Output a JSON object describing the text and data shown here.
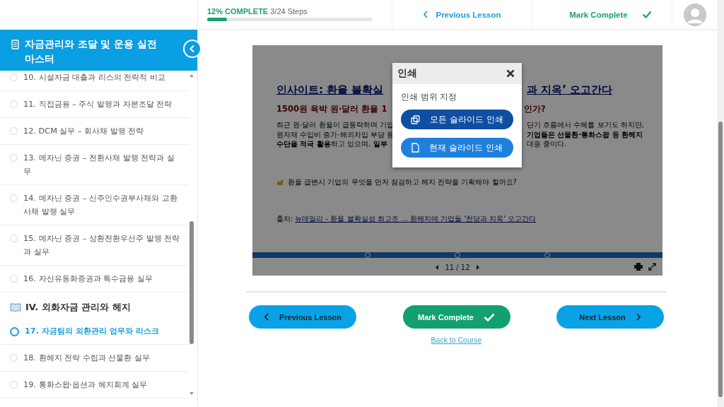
{
  "progress": {
    "percent_label": "12% COMPLETE",
    "steps": "3/24 Steps",
    "level": 0.12
  },
  "top_nav": {
    "previous": "Previous Lesson",
    "mark_complete": "Mark Complete"
  },
  "sidebar": {
    "course_title": "자금관리와 조달 및 운용 실전 마스터",
    "items": [
      {
        "kind": "lesson",
        "label": "10. 시설자금 대출과 리스의 전략적 비교",
        "selected": false
      },
      {
        "kind": "lesson",
        "label": "11. 직접금융 – 주식 발행과 자본조달 전략",
        "selected": false
      },
      {
        "kind": "lesson",
        "label": "12. DCM 실무 – 회사채 발행 전략",
        "selected": false
      },
      {
        "kind": "lesson",
        "label": "13. 메자닌 증권 – 전환사채 발행 전략과 실무",
        "selected": false
      },
      {
        "kind": "lesson",
        "label": "14. 메자닌 증권 – 신주인수권부사채와 교환사채 발행 실무",
        "selected": false
      },
      {
        "kind": "lesson",
        "label": "15. 메자닌 증권 – 상환전환우선주 발행 전략과 실무",
        "selected": false
      },
      {
        "kind": "lesson",
        "label": "16. 자산유동화증권과 특수금융 실무",
        "selected": false
      },
      {
        "kind": "section",
        "label": "IV. 외화자금 관리와 헤지"
      },
      {
        "kind": "lesson",
        "label": "17. 자금팀의 외환관리 업무와 리스크",
        "selected": true
      },
      {
        "kind": "lesson",
        "label": "18. 환헤지 전략 수립과 선물환 실무",
        "selected": false
      },
      {
        "kind": "lesson",
        "label": "19. 통화스왑·옵션과 헤지회계 실무",
        "selected": false
      }
    ]
  },
  "slide": {
    "title_left": "인사이트: 환율 불확실",
    "title_right": "과 지옥’ 오고간다",
    "subtitle_left": "1500원 육박 원·달러 환율 1",
    "subtitle_right": "인가?",
    "body_lines": [
      {
        "left": "최근 원·달러 환율이 급등락하며 기업",
        "right": "단기 흐름에서 수혜를 보기도 하지만,"
      },
      {
        "left": "원자재 수입비 증가·해외차입 부담 등",
        "right": "**기업들은 선물환·통화스왑 등 환헤지**"
      },
      {
        "left": "**수단을 적극 활용**하고 있으며, **일부**",
        "right": "대응 중이다."
      }
    ],
    "question": "환율 급변시 기업의 무엇을 먼저 점검하고 헤지 전략을 기획해야 할까요?",
    "source_label": "출처:",
    "source_link": "뉴데일리 - 환율 불확실성 최고조 … 환헤지에 기업들 '천당과 지옥' 오고간다",
    "pager": "11 / 12"
  },
  "print_dialog": {
    "title": "인쇄",
    "subtitle": "인쇄 범위 지정",
    "options": [
      {
        "kind": "all",
        "label": "모든 슬라이드 인쇄",
        "hovered": true
      },
      {
        "kind": "current",
        "label": "현재 슬라이드 인쇄",
        "hovered": false
      }
    ]
  },
  "footer": {
    "previous": "Previous Lesson",
    "mark_complete": "Mark Complete",
    "next": "Next Lesson",
    "back_link": "Back to Course"
  }
}
